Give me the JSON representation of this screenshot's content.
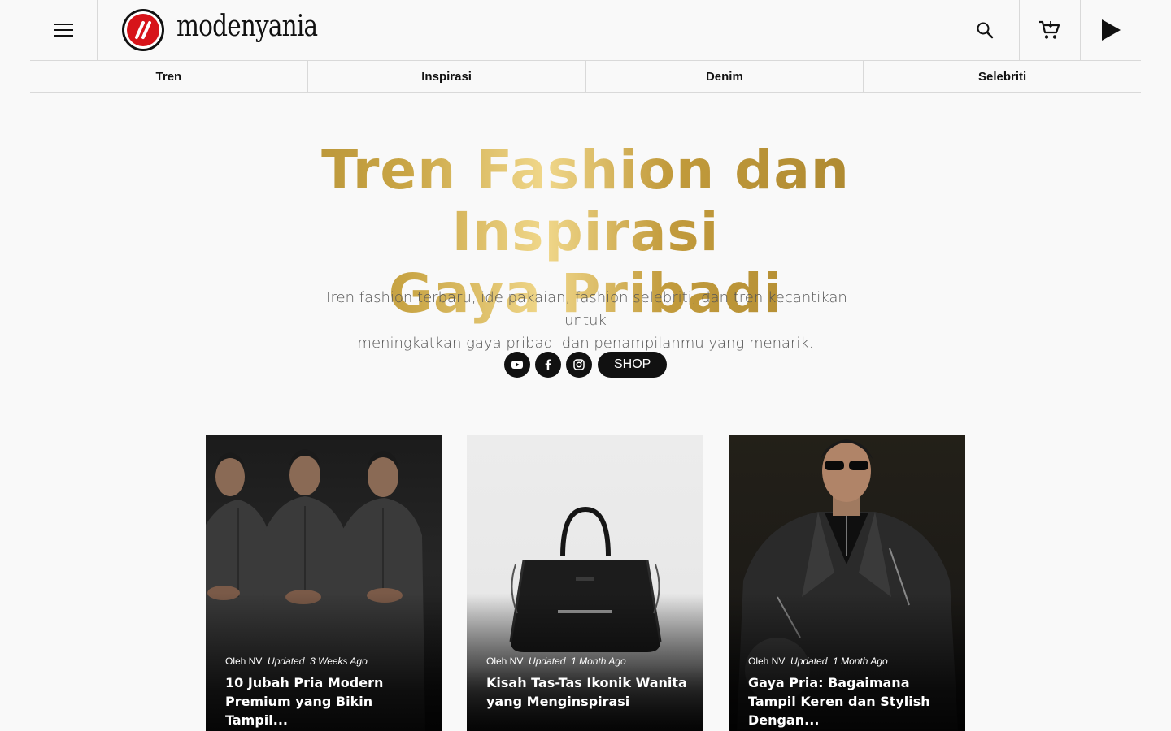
{
  "header": {
    "logo_text": "modenyania",
    "icons": [
      "menu-icon",
      "search-icon",
      "cart-icon",
      "play-icon"
    ]
  },
  "nav": {
    "items": [
      {
        "label": "Tren"
      },
      {
        "label": "Inspirasi"
      },
      {
        "label": "Denim"
      },
      {
        "label": "Selebriti"
      }
    ]
  },
  "hero": {
    "title_line1": "Tren Fashion dan Inspirasi",
    "title_line2": "Gaya Pribadi",
    "subtitle_line1": "Tren fashion terbaru, ide pakaian, fashion selebriti, dan tren kecantikan untuk",
    "subtitle_line2": "meningkatkan gaya pribadi dan penampilanmu yang menarik.",
    "shop_label": "SHOP",
    "social_icons": [
      "youtube-icon",
      "facebook-icon",
      "instagram-icon"
    ]
  },
  "colors": {
    "accent_gold": "#c9a545",
    "logo_red": "#d7141a",
    "text_dark": "#111111"
  },
  "cards": [
    {
      "by": "Oleh NV",
      "updated": "Updated",
      "age": "3 Weeks Ago",
      "title": "10 Jubah Pria Modern Premium yang Bikin Tampil..."
    },
    {
      "by": "Oleh NV",
      "updated": "Updated",
      "age": "1 Month Ago",
      "title": "Kisah Tas-Tas Ikonik Wanita yang Menginspirasi"
    },
    {
      "by": "Oleh NV",
      "updated": "Updated",
      "age": "1 Month Ago",
      "title": "Gaya Pria: Bagaimana Tampil Keren dan Stylish Dengan..."
    }
  ]
}
